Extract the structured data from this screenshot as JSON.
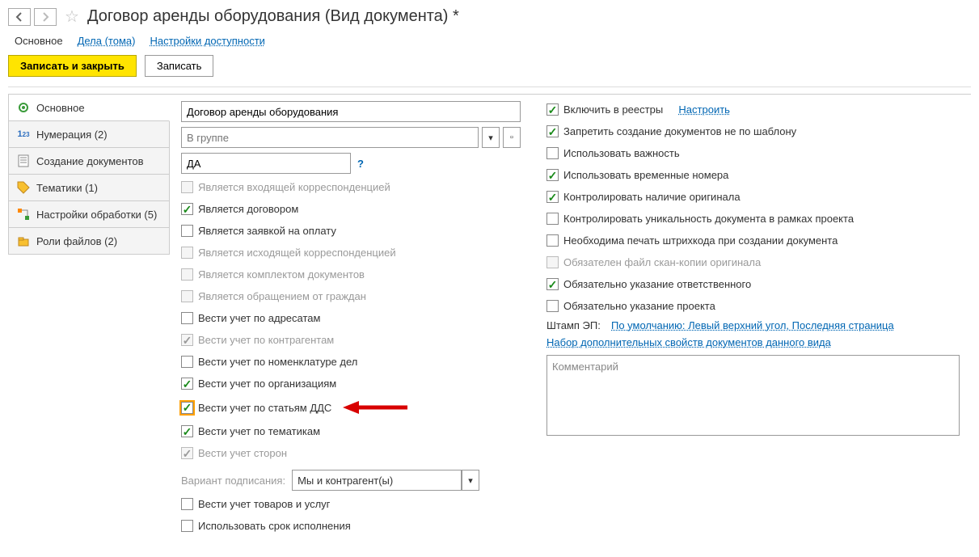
{
  "page_title": "Договор аренды оборудования (Вид документа) *",
  "nav_tabs": {
    "main": "Основное",
    "cases": "Дела (тома)",
    "access": "Настройки доступности"
  },
  "toolbar": {
    "save_close": "Записать и закрыть",
    "save": "Записать"
  },
  "sidebar": {
    "main": "Основное",
    "numbering": "Нумерация (2)",
    "creation": "Создание документов",
    "topics": "Тематики (1)",
    "processing": "Настройки обработки (5)",
    "fileroles": "Роли файлов (2)"
  },
  "form": {
    "name_value": "Договор аренды оборудования",
    "group_placeholder": "В группе",
    "code_value": "ДА",
    "sign_variant_label": "Вариант подписания:",
    "sign_variant_value": "Мы и контрагент(ы)"
  },
  "left_checks": {
    "is_incoming": "Является входящей корреспонденцией",
    "is_contract": "Является договором",
    "is_payment": "Является заявкой на оплату",
    "is_outgoing": "Является исходящей корреспонденцией",
    "is_bundle": "Является комплектом документов",
    "is_appeal": "Является обращением от граждан",
    "by_addressee": "Вести учет по адресатам",
    "by_counterparty": "Вести учет по контрагентам",
    "by_nomenclature": "Вести учет по номенклатуре дел",
    "by_org": "Вести учет по организациям",
    "by_dds": "Вести учет по статьям ДДС",
    "by_topic": "Вести учет по тематикам",
    "by_parties": "Вести учет сторон",
    "goods_services": "Вести учет товаров и услуг",
    "use_deadline": "Использовать срок исполнения"
  },
  "right_checks": {
    "include_registry": "Включить в реестры",
    "configure_link": "Настроить",
    "forbid_nontemplate": "Запретить создание документов не по шаблону",
    "use_importance": "Использовать важность",
    "use_temp_numbers": "Использовать временные номера",
    "control_original": "Контролировать наличие оригинала",
    "control_uniqueness": "Контролировать уникальность документа в рамках проекта",
    "need_barcode": "Необходима печать штрихкода при создании документа",
    "scan_required": "Обязателен файл скан-копии оригинала",
    "responsible_required": "Обязательно указание ответственного",
    "project_required": "Обязательно указание проекта",
    "stamp_label": "Штамп ЭП:",
    "stamp_value": "По умолчанию: Левый верхний угол, Последняя страница",
    "addl_props_link": "Набор дополнительных свойств документов данного вида",
    "comment_placeholder": "Комментарий"
  }
}
